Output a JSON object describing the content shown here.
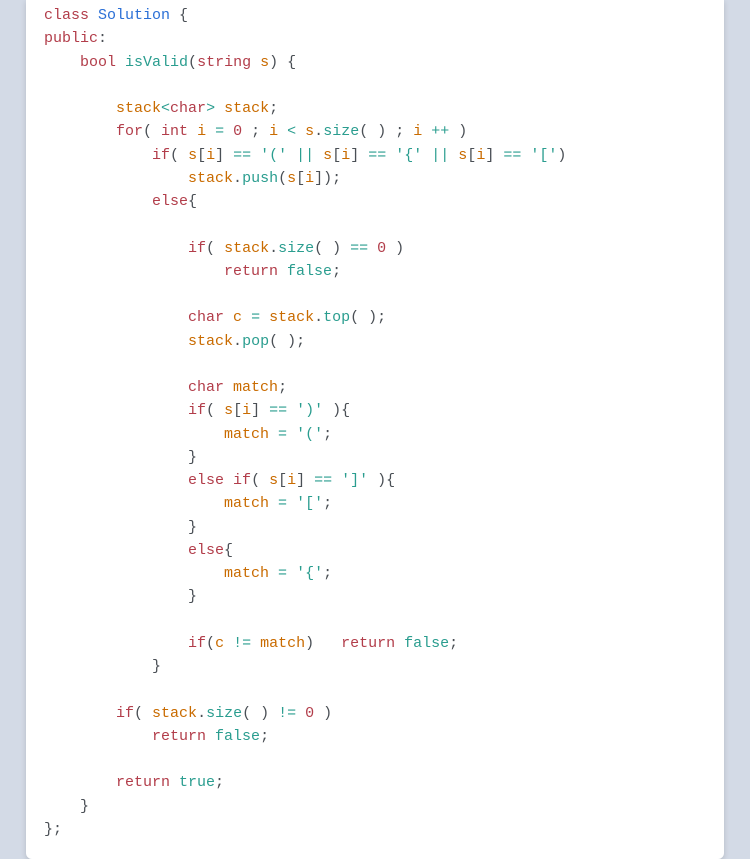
{
  "code": {
    "tokens": [
      [
        [
          "kw",
          "class"
        ],
        [
          "",
          ""
        ],
        [
          "type",
          " Solution"
        ],
        [
          "",
          ""
        ],
        [
          "punct",
          " {"
        ]
      ],
      [
        [
          "kw",
          "public"
        ],
        [
          "punct",
          ":"
        ]
      ],
      [
        [
          "",
          "    "
        ],
        [
          "kw",
          "bool"
        ],
        [
          "",
          ""
        ],
        [
          "fn",
          " isValid"
        ],
        [
          "punct",
          "("
        ],
        [
          "kw",
          "string"
        ],
        [
          "",
          ""
        ],
        [
          "var",
          " s"
        ],
        [
          "punct",
          ") {"
        ]
      ],
      [
        [
          "",
          ""
        ]
      ],
      [
        [
          "",
          "        "
        ],
        [
          "var",
          "stack"
        ],
        [
          "op",
          "<"
        ],
        [
          "kw",
          "char"
        ],
        [
          "op",
          "> "
        ],
        [
          "var",
          "stack"
        ],
        [
          "punct",
          ";"
        ]
      ],
      [
        [
          "",
          "        "
        ],
        [
          "kw",
          "for"
        ],
        [
          "punct",
          "( "
        ],
        [
          "kw",
          "int"
        ],
        [
          "",
          ""
        ],
        [
          "var",
          " i"
        ],
        [
          "",
          ""
        ],
        [
          "op",
          " = "
        ],
        [
          "num",
          "0"
        ],
        [
          "punct",
          " ; "
        ],
        [
          "var",
          "i"
        ],
        [
          "",
          ""
        ],
        [
          "op",
          " < "
        ],
        [
          "var",
          "s"
        ],
        [
          "punct",
          "."
        ],
        [
          "fn",
          "size"
        ],
        [
          "punct",
          "( ) ; "
        ],
        [
          "var",
          "i"
        ],
        [
          "",
          ""
        ],
        [
          "op",
          " ++"
        ],
        [
          "punct",
          " )"
        ]
      ],
      [
        [
          "",
          "            "
        ],
        [
          "kw",
          "if"
        ],
        [
          "punct",
          "( "
        ],
        [
          "var",
          "s"
        ],
        [
          "punct",
          "["
        ],
        [
          "var",
          "i"
        ],
        [
          "punct",
          "]"
        ],
        [
          "",
          ""
        ],
        [
          "op",
          " == "
        ],
        [
          "chr",
          "'('"
        ],
        [
          "",
          ""
        ],
        [
          "op",
          " || "
        ],
        [
          "var",
          "s"
        ],
        [
          "punct",
          "["
        ],
        [
          "var",
          "i"
        ],
        [
          "punct",
          "]"
        ],
        [
          "",
          ""
        ],
        [
          "op",
          " == "
        ],
        [
          "chr",
          "'{'"
        ],
        [
          "",
          ""
        ],
        [
          "op",
          " || "
        ],
        [
          "var",
          "s"
        ],
        [
          "punct",
          "["
        ],
        [
          "var",
          "i"
        ],
        [
          "punct",
          "]"
        ],
        [
          "",
          ""
        ],
        [
          "op",
          " == "
        ],
        [
          "chr",
          "'['"
        ],
        [
          "punct",
          ")"
        ]
      ],
      [
        [
          "",
          "                "
        ],
        [
          "var",
          "stack"
        ],
        [
          "punct",
          "."
        ],
        [
          "fn",
          "push"
        ],
        [
          "punct",
          "("
        ],
        [
          "var",
          "s"
        ],
        [
          "punct",
          "["
        ],
        [
          "var",
          "i"
        ],
        [
          "punct",
          "]);"
        ]
      ],
      [
        [
          "",
          "            "
        ],
        [
          "kw",
          "else"
        ],
        [
          "punct",
          "{"
        ]
      ],
      [
        [
          "",
          ""
        ]
      ],
      [
        [
          "",
          "                "
        ],
        [
          "kw",
          "if"
        ],
        [
          "punct",
          "( "
        ],
        [
          "var",
          "stack"
        ],
        [
          "punct",
          "."
        ],
        [
          "fn",
          "size"
        ],
        [
          "punct",
          "( )"
        ],
        [
          "",
          ""
        ],
        [
          "op",
          " == "
        ],
        [
          "num",
          "0"
        ],
        [
          "punct",
          " )"
        ]
      ],
      [
        [
          "",
          "                    "
        ],
        [
          "kw",
          "return"
        ],
        [
          "",
          ""
        ],
        [
          "lit",
          " false"
        ],
        [
          "punct",
          ";"
        ]
      ],
      [
        [
          "",
          ""
        ]
      ],
      [
        [
          "",
          "                "
        ],
        [
          "kw",
          "char"
        ],
        [
          "",
          ""
        ],
        [
          "var",
          " c"
        ],
        [
          "",
          ""
        ],
        [
          "op",
          " = "
        ],
        [
          "var",
          "stack"
        ],
        [
          "punct",
          "."
        ],
        [
          "fn",
          "top"
        ],
        [
          "punct",
          "( );"
        ]
      ],
      [
        [
          "",
          "                "
        ],
        [
          "var",
          "stack"
        ],
        [
          "punct",
          "."
        ],
        [
          "fn",
          "pop"
        ],
        [
          "punct",
          "( );"
        ]
      ],
      [
        [
          "",
          ""
        ]
      ],
      [
        [
          "",
          "                "
        ],
        [
          "kw",
          "char"
        ],
        [
          "",
          ""
        ],
        [
          "var",
          " match"
        ],
        [
          "punct",
          ";"
        ]
      ],
      [
        [
          "",
          "                "
        ],
        [
          "kw",
          "if"
        ],
        [
          "punct",
          "( "
        ],
        [
          "var",
          "s"
        ],
        [
          "punct",
          "["
        ],
        [
          "var",
          "i"
        ],
        [
          "punct",
          "]"
        ],
        [
          "",
          ""
        ],
        [
          "op",
          " == "
        ],
        [
          "chr",
          "')'"
        ],
        [
          "punct",
          " ){"
        ]
      ],
      [
        [
          "",
          "                    "
        ],
        [
          "var",
          "match"
        ],
        [
          "",
          ""
        ],
        [
          "op",
          " = "
        ],
        [
          "chr",
          "'('"
        ],
        [
          "punct",
          ";"
        ]
      ],
      [
        [
          "",
          "                "
        ],
        [
          "punct",
          "}"
        ]
      ],
      [
        [
          "",
          "                "
        ],
        [
          "kw",
          "else"
        ],
        [
          "",
          ""
        ],
        [
          "kw",
          " if"
        ],
        [
          "punct",
          "( "
        ],
        [
          "var",
          "s"
        ],
        [
          "punct",
          "["
        ],
        [
          "var",
          "i"
        ],
        [
          "punct",
          "]"
        ],
        [
          "",
          ""
        ],
        [
          "op",
          " == "
        ],
        [
          "chr",
          "']'"
        ],
        [
          "punct",
          " ){"
        ]
      ],
      [
        [
          "",
          "                    "
        ],
        [
          "var",
          "match"
        ],
        [
          "",
          ""
        ],
        [
          "op",
          " = "
        ],
        [
          "chr",
          "'['"
        ],
        [
          "punct",
          ";"
        ]
      ],
      [
        [
          "",
          "                "
        ],
        [
          "punct",
          "}"
        ]
      ],
      [
        [
          "",
          "                "
        ],
        [
          "kw",
          "else"
        ],
        [
          "punct",
          "{"
        ]
      ],
      [
        [
          "",
          "                    "
        ],
        [
          "var",
          "match"
        ],
        [
          "",
          ""
        ],
        [
          "op",
          " = "
        ],
        [
          "chr",
          "'{'"
        ],
        [
          "punct",
          ";"
        ]
      ],
      [
        [
          "",
          "                "
        ],
        [
          "punct",
          "}"
        ]
      ],
      [
        [
          "",
          ""
        ]
      ],
      [
        [
          "",
          "                "
        ],
        [
          "kw",
          "if"
        ],
        [
          "punct",
          "("
        ],
        [
          "var",
          "c"
        ],
        [
          "",
          ""
        ],
        [
          "op",
          " != "
        ],
        [
          "var",
          "match"
        ],
        [
          "punct",
          ")   "
        ],
        [
          "kw",
          "return"
        ],
        [
          "",
          ""
        ],
        [
          "lit",
          " false"
        ],
        [
          "punct",
          ";"
        ]
      ],
      [
        [
          "",
          "            "
        ],
        [
          "punct",
          "}"
        ]
      ],
      [
        [
          "",
          ""
        ]
      ],
      [
        [
          "",
          "        "
        ],
        [
          "kw",
          "if"
        ],
        [
          "punct",
          "( "
        ],
        [
          "var",
          "stack"
        ],
        [
          "punct",
          "."
        ],
        [
          "fn",
          "size"
        ],
        [
          "punct",
          "( )"
        ],
        [
          "",
          ""
        ],
        [
          "op",
          " != "
        ],
        [
          "num",
          "0"
        ],
        [
          "punct",
          " )"
        ]
      ],
      [
        [
          "",
          "            "
        ],
        [
          "kw",
          "return"
        ],
        [
          "",
          ""
        ],
        [
          "lit",
          " false"
        ],
        [
          "punct",
          ";"
        ]
      ],
      [
        [
          "",
          ""
        ]
      ],
      [
        [
          "",
          "        "
        ],
        [
          "kw",
          "return"
        ],
        [
          "",
          ""
        ],
        [
          "lit",
          " true"
        ],
        [
          "punct",
          ";"
        ]
      ],
      [
        [
          "",
          "    "
        ],
        [
          "punct",
          "}"
        ]
      ],
      [
        [
          "punct",
          "};"
        ]
      ]
    ]
  }
}
